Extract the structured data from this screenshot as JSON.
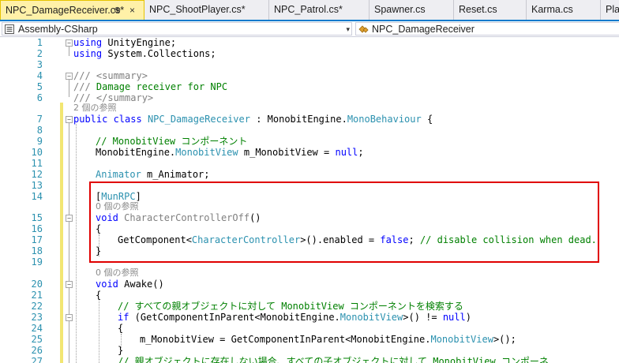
{
  "tabs": [
    {
      "label": "NPC_DamageReceiver.cs*",
      "pin": "⊕",
      "close": "×",
      "active": true
    },
    {
      "label": "NPC_ShootPlayer.cs*"
    },
    {
      "label": "NPC_Patrol.cs*"
    },
    {
      "label": "Spawner.cs"
    },
    {
      "label": "Reset.cs"
    },
    {
      "label": "Karma.cs"
    },
    {
      "label": "Pla"
    }
  ],
  "nav": {
    "project": "Assembly-CSharp",
    "class": "NPC_DamageReceiver",
    "dropdown": "▾"
  },
  "lens": {
    "refs_2": "2 個の参照",
    "refs_0a": "0 個の参照",
    "refs_0b": "0 個の参照"
  },
  "code": {
    "l1_kw": "using",
    "l1_rest": " UnityEngine;",
    "l2_kw": "using",
    "l2_rest": " System.Collections;",
    "l4": "/// <summary>",
    "l5_a": "/// ",
    "l5_b": "Damage receiver for NPC",
    "l6": "/// </summary>",
    "l7_kw1": "public",
    "l7_kw2": " class ",
    "l7_ty1": "NPC_DamageReceiver",
    "l7_mid": " : MonobitEngine.",
    "l7_ty2": "MonoBehaviour",
    "l7_end": " {",
    "l9": "// MonobitView コンポーネント",
    "l10_a": "MonobitEngine.",
    "l10_ty": "MonobitView",
    "l10_b": " m_MonobitView = ",
    "l10_kw": "null",
    "l10_c": ";",
    "l12_ty": "Animator",
    "l12_rest": " m_Animator;",
    "l14_a": "[",
    "l14_ty": "MunRPC",
    "l14_b": "]",
    "l15_kw": "void",
    "l15_mt": " CharacterControllerOff",
    "l15_rest": "()",
    "l16": "{",
    "l17_a": "GetComponent<",
    "l17_ty": "CharacterController",
    "l17_b": ">().enabled = ",
    "l17_kw": "false",
    "l17_c": "; ",
    "l17_cm": "// disable collision when dead.",
    "l18": "}",
    "l20_kw": "void",
    "l20_rest": " Awake()",
    "l21": "{",
    "l22": "// すべての親オブジェクトに対して MonobitView コンポーネントを検索する",
    "l23_kw": "if",
    "l23_a": " (GetComponentInParent<MonobitEngine.",
    "l23_ty": "MonobitView",
    "l23_b": ">() != ",
    "l23_kw2": "null",
    "l23_c": ")",
    "l24": "{",
    "l25_a": "m_MonobitView = GetComponentInParent<MonobitEngine.",
    "l25_ty": "MonobitView",
    "l25_b": ">();",
    "l26": "}",
    "l27": "// 親オブジェクトに存在しない場合、すべての子オブジェクトに対して MonobitView コンポーネ"
  },
  "line_numbers": [
    "1",
    "2",
    "3",
    "4",
    "5",
    "6",
    "7",
    "8",
    "9",
    "10",
    "11",
    "12",
    "13",
    "14",
    "15",
    "16",
    "17",
    "18",
    "19",
    "20",
    "21",
    "22",
    "23",
    "24",
    "25",
    "26",
    "27"
  ],
  "colors": {
    "keyword": "#0000ff",
    "type": "#2b91af",
    "comment": "#008000",
    "line_number": "#2b91af",
    "highlight_box": "#e00000",
    "change_bar": "#f2e672",
    "active_tab": "#fff1a8"
  }
}
